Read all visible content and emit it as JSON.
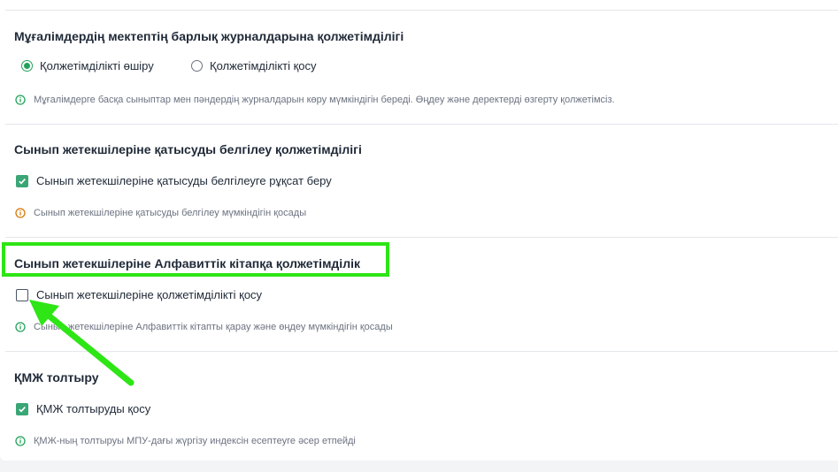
{
  "colors": {
    "accent_green": "#22a35a",
    "checkbox_green": "#3aa676",
    "info_green": "#22a35a",
    "info_orange": "#d97706",
    "highlight": "#2ee516"
  },
  "sections": [
    {
      "title": "Мұғалімдердің мектептің барлық журналдарына қолжетімділігі",
      "options": [
        {
          "type": "radio",
          "label": "Қолжетімділікті өшіру",
          "selected": true
        },
        {
          "type": "radio",
          "label": "Қолжетімділікті қосу",
          "selected": false
        }
      ],
      "hint": "Мұғалімдерге басқа сыныптар мен пәндердің журналдарын көру мүмкіндігін береді. Өңдеу және деректерді өзгерту қолжетімсіз.",
      "hint_icon": "info-icon-green"
    },
    {
      "title": "Сынып жетекшілеріне қатысуды белгілеу қолжетімділігі",
      "options": [
        {
          "type": "checkbox",
          "label": "Сынып жетекшілеріне қатысуды белгілеуге рұқсат беру",
          "checked": true
        }
      ],
      "hint": "Сынып жетекшілеріне қатысуды белгілеу мүмкіндігін қосады",
      "hint_icon": "info-icon-orange"
    },
    {
      "title": "Сынып жетекшілеріне Алфавиттік кітапқа қолжетімділік",
      "options": [
        {
          "type": "checkbox",
          "label": "Сынып жетекшілеріне қолжетімділікті қосу",
          "checked": false
        }
      ],
      "hint": "Сынып жетекшілеріне Алфавиттік кітапты қарау және өңдеу мүмкіндігін қосады",
      "hint_icon": "info-icon-green"
    },
    {
      "title": "ҚМЖ толтыру",
      "options": [
        {
          "type": "checkbox",
          "label": "ҚМЖ толтыруды қосу",
          "checked": true
        }
      ],
      "hint": "ҚМЖ-ның толтыруы МПУ-дағы жүргізу индексін есептеуге әсер етпейді",
      "hint_icon": "info-icon-green"
    }
  ]
}
